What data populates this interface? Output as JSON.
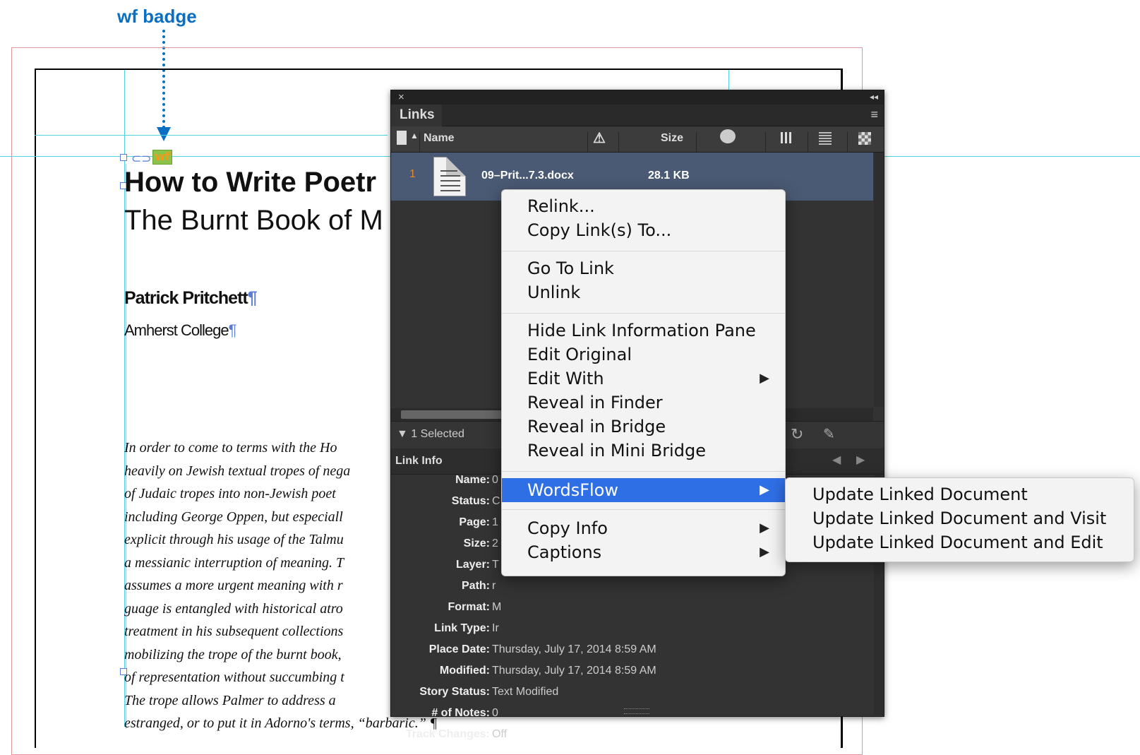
{
  "annotation": {
    "label": "wf badge"
  },
  "document": {
    "badge": "wf",
    "title": "How to Write Poetr",
    "subtitle": "The Burnt Book of M",
    "author": "Patrick Pritchett",
    "institution": "Amherst College",
    "pilcrow": "¶",
    "body_lines": [
      "In order to come to terms with the Ho",
      "heavily on Jewish textual tropes of nega",
      "of Judaic tropes into non-Jewish poet",
      "including George Oppen, but especiall",
      "explicit through his usage of the Talmu",
      "a messianic interruption of meaning. T",
      "assumes a more urgent meaning with r",
      "guage is entangled with historical atro",
      "treatment in his subsequent collections",
      "mobilizing the trope of the burnt book,",
      "of representation without succumbing t",
      "The trope allows Palmer to address a",
      "estranged, or to put it in Adorno's terms, “barbaric.” ¶"
    ]
  },
  "links_panel": {
    "close_icon": "×",
    "collapse_icon": "◂◂",
    "tab": "Links",
    "menu_icon": "≡",
    "columns": {
      "name": "Name",
      "size": "Size",
      "warning_icon": "⚠"
    },
    "row": {
      "number": "1",
      "name": "09–Prit...7.3.docx",
      "size": "28.1 KB"
    },
    "selected_label": "1 Selected",
    "info_header": "Link Info",
    "info": [
      {
        "key": "Name:",
        "value": "0"
      },
      {
        "key": "Status:",
        "value": "C"
      },
      {
        "key": "Page:",
        "value": "1"
      },
      {
        "key": "Size:",
        "value": "2"
      },
      {
        "key": "Layer:",
        "value": "T"
      },
      {
        "key": "Path:",
        "value": "r"
      },
      {
        "key": "Format:",
        "value": "M"
      },
      {
        "key": "Link Type:",
        "value": "Ir"
      },
      {
        "key": "Place Date:",
        "value": "Thursday, July 17, 2014 8:59 AM"
      },
      {
        "key": "Modified:",
        "value": "Thursday, July 17, 2014 8:59 AM"
      },
      {
        "key": "Story Status:",
        "value": "Text Modified"
      },
      {
        "key": "# of Notes:",
        "value": "0"
      },
      {
        "key": "Track Changes:",
        "value": "Off"
      }
    ]
  },
  "context_menu": {
    "items": [
      {
        "label": "Relink...",
        "submenu": false
      },
      {
        "label": "Copy Link(s) To...",
        "submenu": false
      },
      {
        "label": "Go To Link",
        "submenu": false
      },
      {
        "label": "Unlink",
        "submenu": false
      },
      {
        "label": "Hide Link Information Pane",
        "submenu": false
      },
      {
        "label": "Edit Original",
        "submenu": false
      },
      {
        "label": "Edit With",
        "submenu": true
      },
      {
        "label": "Reveal in Finder",
        "submenu": false
      },
      {
        "label": "Reveal in Bridge",
        "submenu": false
      },
      {
        "label": "Reveal in Mini Bridge",
        "submenu": false
      },
      {
        "label": "WordsFlow",
        "submenu": true,
        "highlighted": true
      },
      {
        "label": "Copy Info",
        "submenu": true
      },
      {
        "label": "Captions",
        "submenu": true
      }
    ],
    "submenu_arrow": "▶"
  },
  "submenu": {
    "items": [
      "Update Linked Document",
      "Update Linked Document and Visit",
      "Update Linked Document and Edit"
    ]
  },
  "colors": {
    "highlight": "#2f6fe6",
    "annotation": "#0a6fc2",
    "guide": "#4fd3df",
    "bleed": "#e3959b"
  }
}
